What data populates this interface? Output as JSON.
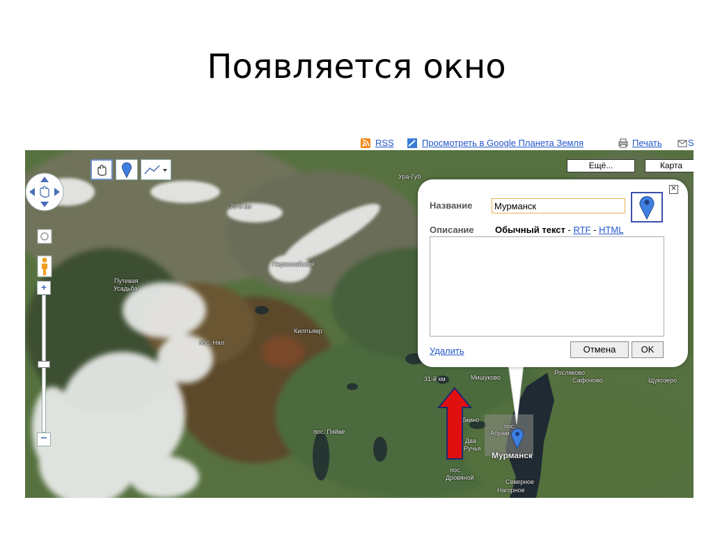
{
  "slide": {
    "title": "Появляется окно"
  },
  "topbar": {
    "rss_label": "RSS",
    "earth_label": "Просмотреть в Google Планета Земля",
    "print_label": "Печать",
    "more_cut": "S"
  },
  "toolbar": {
    "hand_icon": "hand-icon",
    "placemark_icon": "placemark-icon",
    "line_icon": "line-icon",
    "more_label": "Ещё...",
    "map_label": "Карта"
  },
  "map_labels": {
    "ura_guba": "Ура-Губ",
    "km70": "70-й км",
    "pervomaisky": "Первомайский",
    "putevaya": "Путевая",
    "usadba": "Усадьба",
    "nyal": "пос. Нял",
    "kilpyavr": "Килпъявр",
    "km31": "31-й км",
    "mishukovo": "Мишуково",
    "roslyakovo": "Росляково",
    "safonovo": "Сафоново",
    "shchukozero": "Щукозеро",
    "pyaive": "пос. Пяйве",
    "bkino": "бкино",
    "dva": "Два",
    "ruchya": "Ручья",
    "pos_small": "пос.",
    "abramovsky": "Абрам",
    "murmansk": "Мурманск",
    "pos": "пос.",
    "drovyanoy": "Дровяной",
    "severnoe": "Северное",
    "nagornoe": "Нагорное"
  },
  "dialog": {
    "name_label": "Название",
    "name_value": "Мурманск",
    "desc_label": "Описание",
    "plain_text": "Обычный текст",
    "sep1": " - ",
    "rtf": "RTF",
    "sep2": " - ",
    "html": "HTML",
    "description_value": "",
    "delete_label": "Удалить",
    "cancel_label": "Отмена",
    "ok_label": "OK",
    "close_label": "✕"
  },
  "colors": {
    "link": "#2255cc",
    "arrow": "#e01010",
    "pin": "#3f7fe0"
  }
}
